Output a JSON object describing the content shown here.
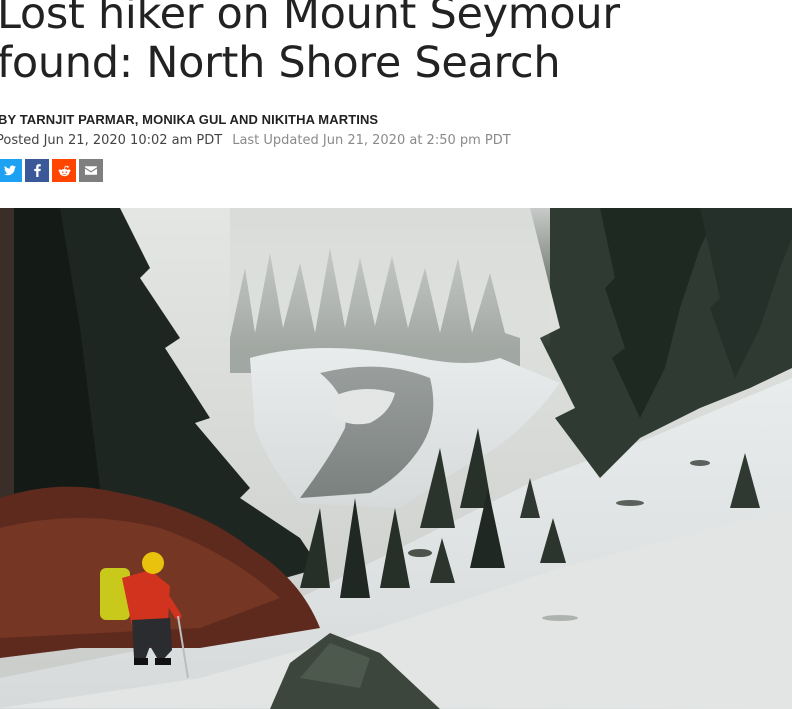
{
  "article": {
    "headline_line1": "Lost hiker on Mount Seymour",
    "headline_line2": "found: North Shore Search",
    "byline": "BY TARNJIT PARMAR, MONIKA GUL AND NIKITHA MARTINS",
    "posted": "Posted Jun 21, 2020 10:02 am PDT",
    "last_updated": "Last Updated Jun 21, 2020 at 2:50 pm PDT"
  },
  "share": [
    {
      "name": "twitter",
      "icon": "twitter-icon",
      "color": "#1da1f2"
    },
    {
      "name": "facebook",
      "icon": "facebook-icon",
      "color": "#3b5998"
    },
    {
      "name": "reddit",
      "icon": "reddit-icon",
      "color": "#ff4500"
    },
    {
      "name": "email",
      "icon": "email-icon",
      "color": "#7f7f7f"
    }
  ],
  "hero_image": {
    "subject": "hiker in red jacket and yellow helmet descending snowy forested slope toward a frozen lake"
  },
  "colors": {
    "headline": "#222222",
    "byline": "#222222",
    "posted": "#444444",
    "updated": "#8a8a8a"
  }
}
